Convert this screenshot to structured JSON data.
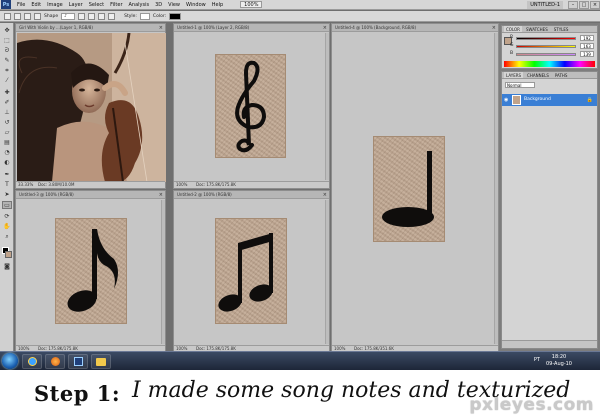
{
  "menubar": {
    "app_icon": "Ps",
    "items": [
      "File",
      "Edit",
      "Image",
      "Layer",
      "Select",
      "Filter",
      "Analysis",
      "3D",
      "View",
      "Window",
      "Help"
    ],
    "zoom": "100%",
    "workspace": "UNTITLED-1",
    "window_buttons": [
      "–",
      "□",
      "×"
    ]
  },
  "options": {
    "shape_label": "Shape",
    "style_label": "Style:",
    "color_label": "Color:"
  },
  "documents": [
    {
      "title": "Girl With Violin by ...(Layer 1, RGB/8)",
      "zoom": "33.33%",
      "doc": "Doc: 3.80M/10.0M"
    },
    {
      "title": "Untitled-1 @ 100% (Layer 2, RGB/8)",
      "zoom": "100%",
      "doc": "Doc: 175.8K/175.8K"
    },
    {
      "title": "Untitled-4 @ 100% (Background, RGB/8)",
      "zoom": "100%",
      "doc": "Doc: 175.8K/351.6K"
    },
    {
      "title": "Untitled-3 @ 100% (RGB/8)",
      "zoom": "100%",
      "doc": "Doc: 175.8K/175.8K"
    },
    {
      "title": "Untitled-2 @ 100% (RGB/8)",
      "zoom": "100%",
      "doc": "Doc: 175.8K/175.8K"
    }
  ],
  "panels": {
    "color_tabs": [
      "COLOR",
      "SWATCHES",
      "STYLES"
    ],
    "channels": [
      {
        "label": "R",
        "value": "192"
      },
      {
        "label": "G",
        "value": "163"
      },
      {
        "label": "B",
        "value": "139"
      }
    ],
    "layers_tabs": [
      "LAYERS",
      "CHANNELS",
      "PATHS"
    ],
    "blend_mode": "Normal",
    "layer_name": "Background",
    "fg_color": "#c0a38b",
    "layer_highlight": "#3a7fd5"
  },
  "taskbar": {
    "time": "18:20",
    "date": "09-Aug-10",
    "lang": "PT"
  },
  "caption": {
    "step": "Step 1:",
    "text": "I made some song notes and texturized"
  },
  "watermark": "pxleyes.com"
}
